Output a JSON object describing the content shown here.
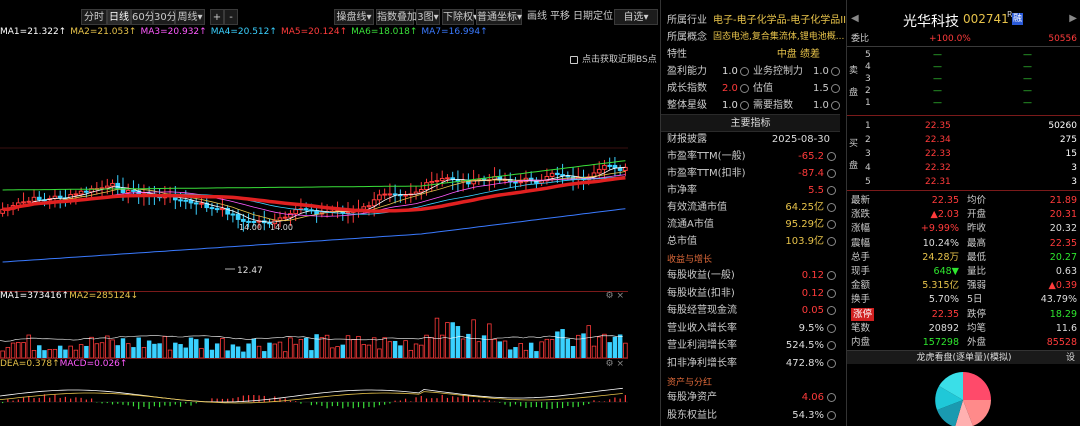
{
  "toolbar": {
    "periods": [
      "分时",
      "日线",
      "60分",
      "30分"
    ],
    "active_period": "日线",
    "week_label": "周线",
    "plus": "+",
    "minus": "-",
    "tools": [
      "操盘线",
      "指数叠加",
      "3图",
      "下除权",
      "普通坐标"
    ],
    "tool_arrow": "▾",
    "plain": [
      "画线",
      "平移",
      "日期定位"
    ],
    "watchlist": "自选"
  },
  "ma_legend": [
    {
      "text": "MA1=21.322↑",
      "color": "#ffffff"
    },
    {
      "text": "MA2=21.053↑",
      "color": "#e6c24a"
    },
    {
      "text": "MA3=20.932↑",
      "color": "#ff5aff"
    },
    {
      "text": "MA4=20.512↑",
      "color": "#3ad1ff"
    },
    {
      "text": "MA5=20.124↑",
      "color": "#ff3b3b"
    },
    {
      "text": "MA6=18.018↑",
      "color": "#3ae03a"
    },
    {
      "text": "MA7=16.994↑",
      "color": "#3a7aff"
    }
  ],
  "main_chart": {
    "bs_note": "点击获取近期BS点",
    "low_marker": "12.47",
    "mid_marker_1": "14.00",
    "mid_marker_2": "14.00"
  },
  "volume_legend": [
    {
      "text": "MA1=373416↑",
      "color": "#ffffff"
    },
    {
      "text": "MA2=285124↓",
      "color": "#e6c24a"
    }
  ],
  "macd_legend": [
    {
      "text": "DEA=0.378↑",
      "color": "#e6c24a"
    },
    {
      "text": "MACD=0.026↑",
      "color": "#ff5aff"
    }
  ],
  "industry": {
    "label": "所属行业",
    "value": "电子-电子化学品-电子化学品II"
  },
  "concept": {
    "label": "所属概念",
    "value": "固态电池,复合集流体,锂电池概..."
  },
  "traits": {
    "label": "特性",
    "value": "中盘  绩差"
  },
  "ratings": [
    {
      "label": "盈利能力",
      "value": "1.0",
      "label2": "业务控制力",
      "value2": "1.0"
    },
    {
      "label": "成长指数",
      "value": "2.0",
      "label2": "估值",
      "value2": "1.5"
    },
    {
      "label": "整体星级",
      "value": "1.0",
      "label2": "需要指数",
      "value2": "1.0"
    }
  ],
  "main_indicators": {
    "title": "主要指标",
    "report_label": "财报披露",
    "report_date": "2025-08-30",
    "rows": [
      {
        "label": "市盈率TTM(一般)",
        "value": "-65.2",
        "color": "red"
      },
      {
        "label": "市盈率TTM(扣非)",
        "value": "-87.4",
        "color": "red"
      },
      {
        "label": "市净率",
        "value": "5.5",
        "color": "red"
      },
      {
        "label": "有效流通市值",
        "value": "64.25亿",
        "color": "yellow"
      },
      {
        "label": "流通A市值",
        "value": "95.29亿",
        "color": "yellow"
      },
      {
        "label": "总市值",
        "value": "103.9亿",
        "color": "yellow"
      }
    ]
  },
  "growth": {
    "title": "收益与增长",
    "rows": [
      {
        "label": "每股收益(一般)",
        "value": "0.12",
        "color": "red"
      },
      {
        "label": "每股收益(扣非)",
        "value": "0.12",
        "color": "red"
      },
      {
        "label": "每股经营现金流",
        "value": "0.05",
        "color": "red"
      },
      {
        "label": "营业收入增长率",
        "value": "9.5%",
        "color": ""
      },
      {
        "label": "营业利润增长率",
        "value": "524.5%",
        "color": ""
      },
      {
        "label": "扣非净利增长率",
        "value": "472.8%",
        "color": ""
      }
    ]
  },
  "assets": {
    "title": "资产与分红",
    "rows": [
      {
        "label": "每股净资产",
        "value": "4.06",
        "color": "red"
      },
      {
        "label": "股东权益比",
        "value": "54.3%",
        "color": ""
      }
    ]
  },
  "quote": {
    "name": "光华科技",
    "code": "002741",
    "badge": "R",
    "badge2": "融",
    "weibi_label": "委比",
    "weibi_value": "+100.0%",
    "weicha_value": "50556",
    "sell_side": "卖",
    "buy_side": "买",
    "pan": "盘",
    "asks": [
      {
        "level": "5",
        "price": "—",
        "vol": "—"
      },
      {
        "level": "4",
        "price": "—",
        "vol": "—"
      },
      {
        "level": "3",
        "price": "—",
        "vol": "—"
      },
      {
        "level": "2",
        "price": "—",
        "vol": "—"
      },
      {
        "level": "1",
        "price": "—",
        "vol": "—"
      }
    ],
    "bids": [
      {
        "level": "1",
        "price": "22.35",
        "vol": "50260"
      },
      {
        "level": "2",
        "price": "22.34",
        "vol": "275"
      },
      {
        "level": "3",
        "price": "22.33",
        "vol": "15"
      },
      {
        "level": "4",
        "price": "22.32",
        "vol": "3"
      },
      {
        "level": "5",
        "price": "22.31",
        "vol": "3"
      }
    ],
    "stats": [
      {
        "l1": "最新",
        "v1": "22.35",
        "c1": "red",
        "l2": "均价",
        "v2": "21.89",
        "c2": "red"
      },
      {
        "l1": "涨跌",
        "v1": "▲2.03",
        "c1": "red",
        "l2": "开盘",
        "v2": "20.31",
        "c2": "red"
      },
      {
        "l1": "涨幅",
        "v1": "+9.99%",
        "c1": "red",
        "l2": "昨收",
        "v2": "20.32",
        "c2": ""
      },
      {
        "l1": "震幅",
        "v1": "10.24%",
        "c1": "",
        "l2": "最高",
        "v2": "22.35",
        "c2": "red"
      },
      {
        "l1": "总手",
        "v1": "24.28万",
        "c1": "yellow",
        "l2": "最低",
        "v2": "20.27",
        "c2": "green"
      },
      {
        "l1": "现手",
        "v1": "648▼",
        "c1": "green",
        "l2": "量比",
        "v2": "0.63",
        "c2": ""
      },
      {
        "l1": "金额",
        "v1": "5.315亿",
        "c1": "yellow",
        "l2": "强弱",
        "v2": "▲0.39",
        "c2": "red"
      },
      {
        "l1": "换手",
        "v1": "5.70%",
        "c1": "",
        "l2": "5日",
        "v2": "43.79%",
        "c2": ""
      },
      {
        "l1": "涨停",
        "v1": "22.35",
        "c1": "red",
        "l2": "跌停",
        "v2": "18.29",
        "c2": "green"
      },
      {
        "l1": "笔数",
        "v1": "20892",
        "c1": "",
        "l2": "均笔",
        "v2": "11.6",
        "c2": ""
      },
      {
        "l1": "内盘",
        "v1": "157298",
        "c1": "green",
        "l2": "外盘",
        "v2": "85528",
        "c2": "red"
      }
    ],
    "dragon_title": "龙虎看盘(逐单量)(模拟)",
    "settings_label": "设"
  },
  "colors": {
    "up": "#ff3b3b",
    "down": "#3ad1ff",
    "ma_main": "#e02020",
    "ma_green": "#3ae03a",
    "ma_blue": "#3a7aff"
  }
}
